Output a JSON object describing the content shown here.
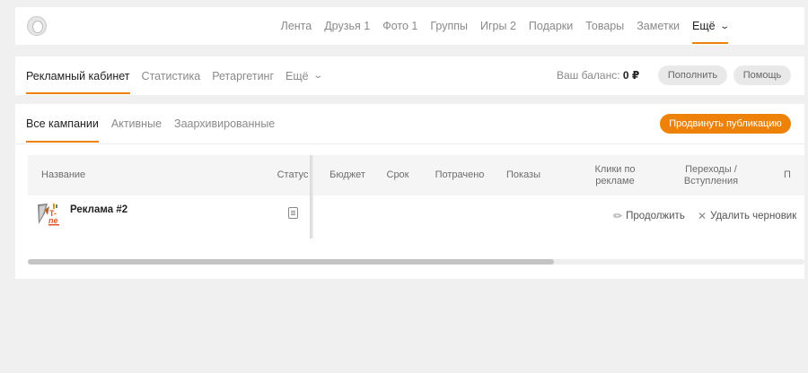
{
  "topnav": {
    "items": [
      {
        "label": "Лента",
        "active": false
      },
      {
        "label": "Друзья 1",
        "active": false
      },
      {
        "label": "Фото 1",
        "active": false
      },
      {
        "label": "Группы",
        "active": false
      },
      {
        "label": "Игры 2",
        "active": false
      },
      {
        "label": "Подарки",
        "active": false
      },
      {
        "label": "Товары",
        "active": false
      },
      {
        "label": "Заметки",
        "active": false
      },
      {
        "label": "Ещё",
        "active": true
      }
    ]
  },
  "subnav": {
    "tabs": [
      {
        "label": "Рекламный кабинет",
        "active": true
      },
      {
        "label": "Статистика",
        "active": false
      },
      {
        "label": "Ретаргетинг",
        "active": false
      },
      {
        "label": "Ещё",
        "active": false
      }
    ],
    "balance_label": "Ваш баланс:",
    "balance_value": "0 ₽",
    "topup_label": "Пополнить",
    "help_label": "Помощь"
  },
  "campaigns": {
    "tabs": [
      {
        "label": "Все кампании",
        "active": true
      },
      {
        "label": "Активные",
        "active": false
      },
      {
        "label": "Заархивированные",
        "active": false
      }
    ],
    "promote_label": "Продвинуть публикацию",
    "columns": {
      "name": "Название",
      "status": "Статус",
      "budget": "Бюджет",
      "term": "Срок",
      "spent": "Потрачено",
      "impressions": "Показы",
      "clicks": "Клики по рекламе",
      "transitions": "Переходы / Вступления",
      "more": "П"
    },
    "rows": [
      {
        "name": "Реклама #2",
        "continue_label": "Продолжить",
        "delete_label": "Удалить черновик"
      }
    ],
    "scroll_position": 0.0
  },
  "colors": {
    "accent": "#ee8208",
    "background": "#f0f0f0"
  }
}
